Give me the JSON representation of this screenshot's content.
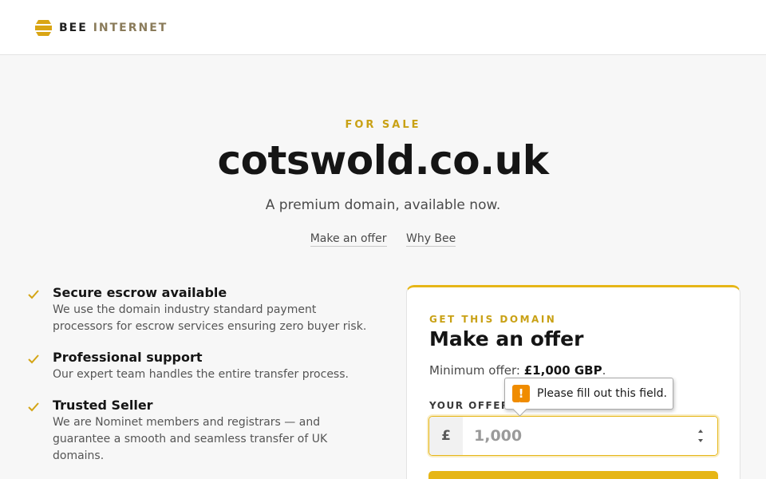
{
  "header": {
    "logo_bold": "BEE",
    "logo_light": "INTERNET"
  },
  "hero": {
    "eyebrow": "FOR SALE",
    "domain": "cotswold.co.uk",
    "subtitle": "A premium domain, available now.",
    "links": [
      "Make an offer",
      "Why Bee"
    ]
  },
  "features": [
    {
      "title": "Secure escrow available",
      "desc": "We use the domain industry standard payment processors for escrow services ensuring zero buyer risk."
    },
    {
      "title": "Professional support",
      "desc": "Our expert team handles the entire transfer process."
    },
    {
      "title": "Trusted Seller",
      "desc": "We are Nominet members and registrars — and guarantee a smooth and seamless transfer of UK domains."
    }
  ],
  "offer_card": {
    "eyebrow": "GET THIS DOMAIN",
    "title": "Make an offer",
    "min_label": "Minimum offer: ",
    "min_value": "£1,000 GBP",
    "min_suffix": ".",
    "field_label": "YOUR OFFER",
    "currency_symbol": "£",
    "placeholder": "1,000",
    "value": ""
  },
  "validation_tooltip": {
    "icon": "!",
    "message": "Please fill out this field."
  },
  "colors": {
    "accent": "#e6b617",
    "accent_text": "#c9a115",
    "warning": "#f08c00"
  },
  "icons": {
    "logo": "bee-logo-icon",
    "feature_check": "check-icon",
    "stepper": "spinner-arrows-icon",
    "warning": "warning-icon"
  }
}
